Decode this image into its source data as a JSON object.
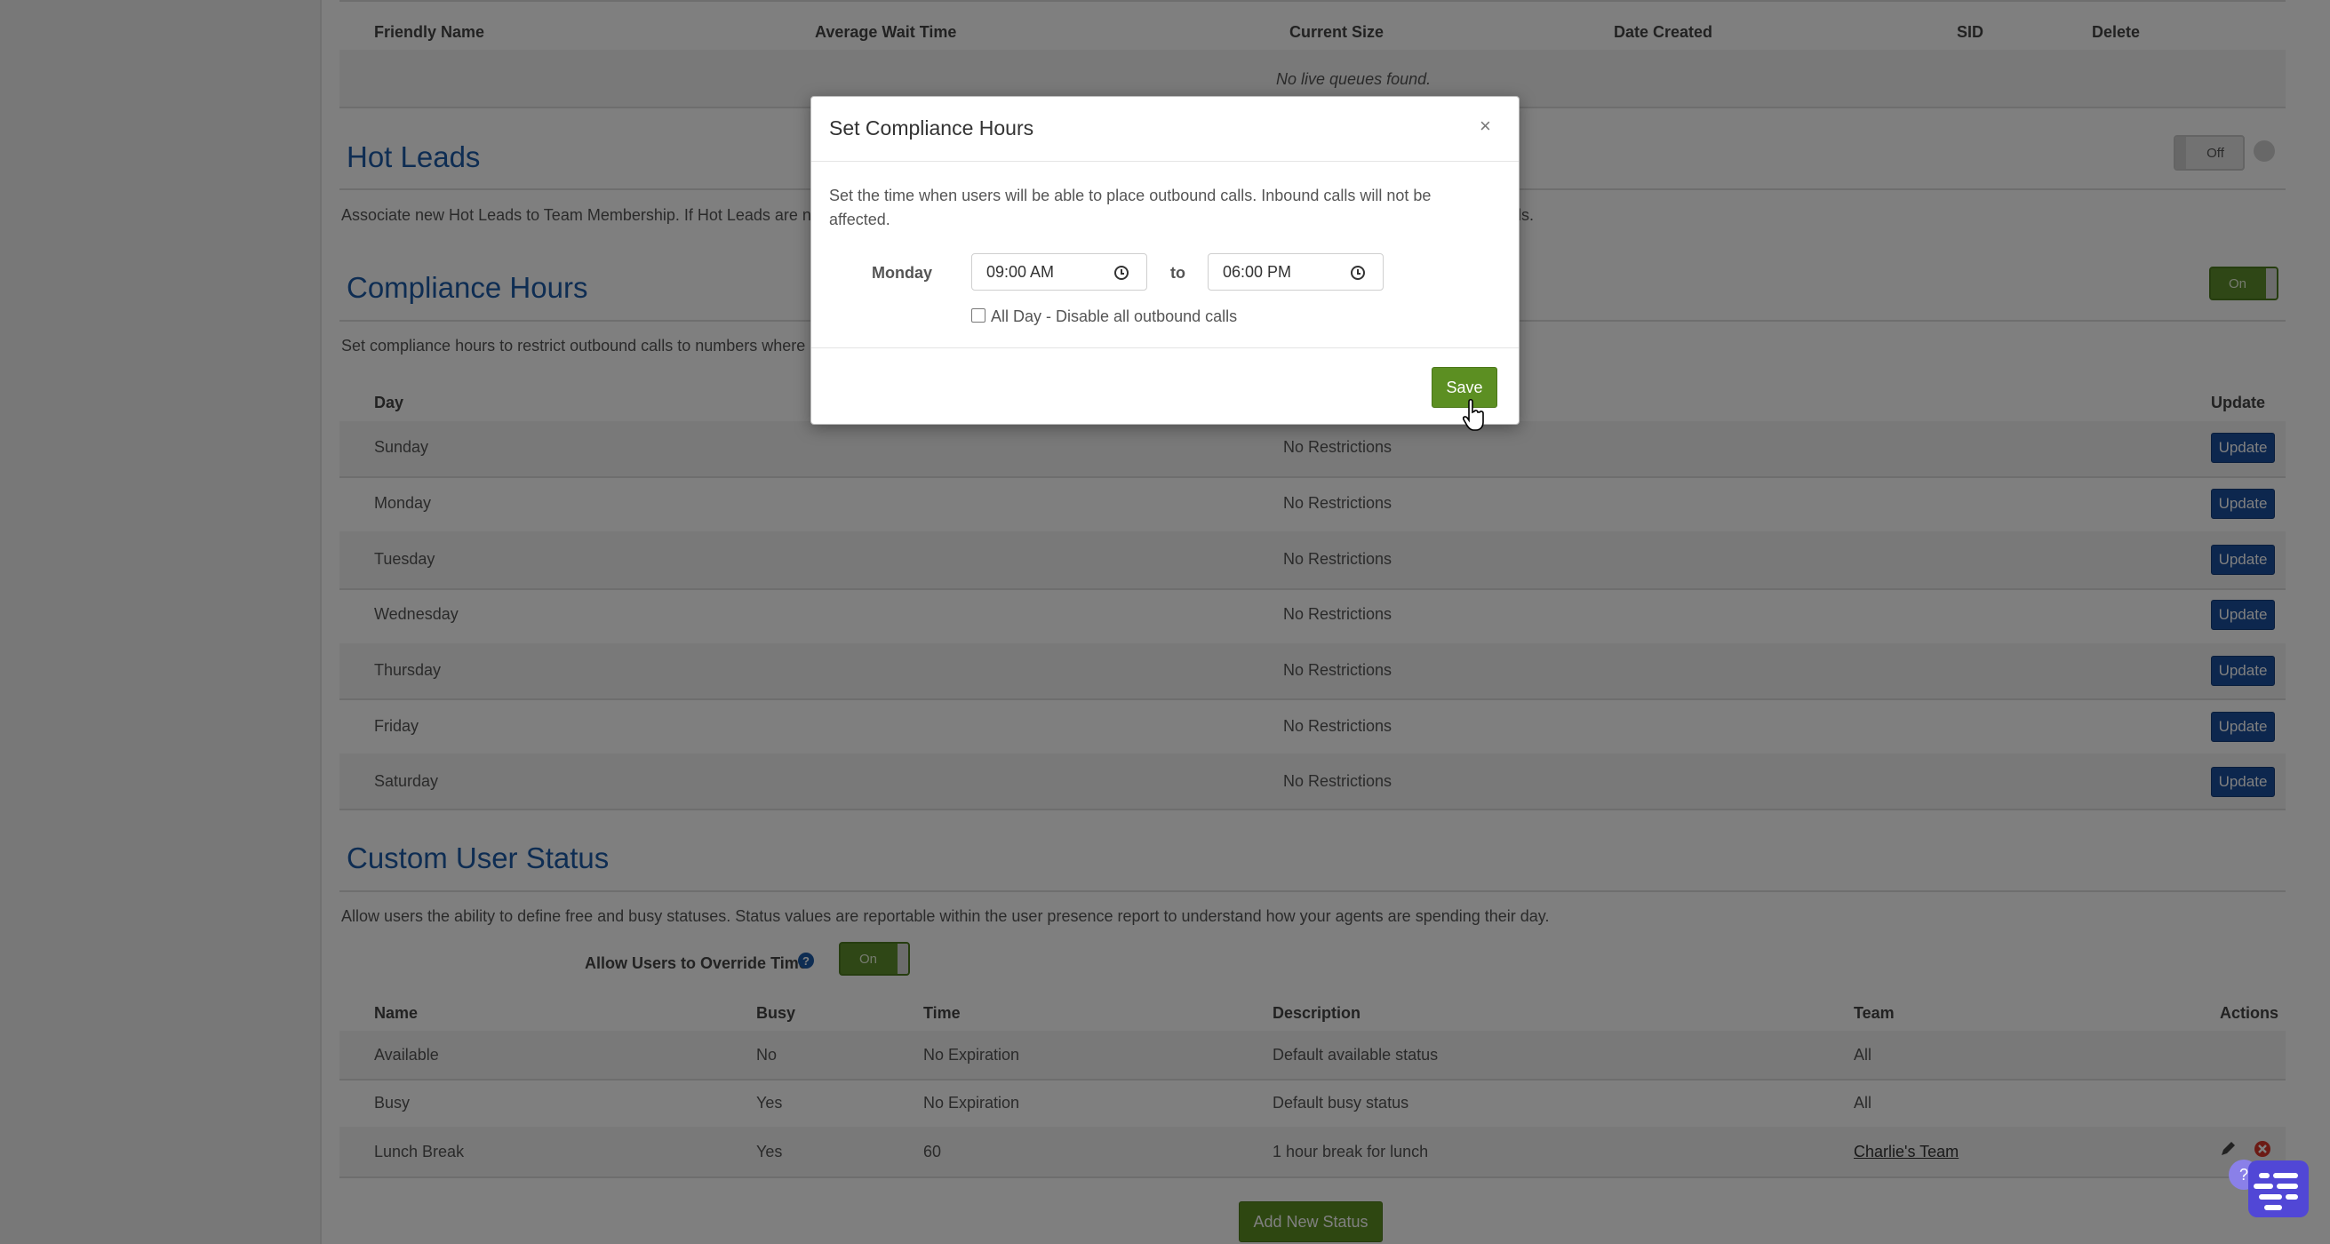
{
  "queues_table": {
    "headers": [
      "Friendly Name",
      "Average Wait Time",
      "Current Size",
      "Date Created",
      "SID",
      "Delete"
    ],
    "empty_text": "No live queues found."
  },
  "hot_leads": {
    "title": "Hot Leads",
    "description": "Associate new Hot Leads to Team Membership. If Hot Leads are no",
    "description_tail": "ds.",
    "toggle_label": "Off"
  },
  "compliance": {
    "title": "Compliance Hours",
    "description": "Set compliance hours to restrict outbound calls to numbers where",
    "toggle_label": "On",
    "headers": {
      "day": "Day",
      "update": "Update"
    },
    "rows": [
      {
        "day": "Sunday",
        "status": "No Restrictions",
        "action": "Update"
      },
      {
        "day": "Monday",
        "status": "No Restrictions",
        "action": "Update"
      },
      {
        "day": "Tuesday",
        "status": "No Restrictions",
        "action": "Update"
      },
      {
        "day": "Wednesday",
        "status": "No Restrictions",
        "action": "Update"
      },
      {
        "day": "Thursday",
        "status": "No Restrictions",
        "action": "Update"
      },
      {
        "day": "Friday",
        "status": "No Restrictions",
        "action": "Update"
      },
      {
        "day": "Saturday",
        "status": "No Restrictions",
        "action": "Update"
      }
    ]
  },
  "custom_status": {
    "title": "Custom User Status",
    "description": "Allow users the ability to define free and busy statuses. Status values are reportable within the user presence report to understand how your agents are spending their day.",
    "override_label": "Allow Users to Override Time",
    "override_toggle": "On",
    "headers": [
      "Name",
      "Busy",
      "Time",
      "Description",
      "Team",
      "Actions"
    ],
    "rows": [
      {
        "name": "Available",
        "busy": "No",
        "time": "No Expiration",
        "description": "Default available status",
        "team": "All"
      },
      {
        "name": "Busy",
        "busy": "Yes",
        "time": "No Expiration",
        "description": "Default busy status",
        "team": "All"
      },
      {
        "name": "Lunch Break",
        "busy": "Yes",
        "time": "60",
        "description": "1 hour break for lunch",
        "team": "Charlie's Team"
      }
    ],
    "add_button": "Add New Status"
  },
  "modal": {
    "title": "Set Compliance Hours",
    "close": "×",
    "text": "Set the time when users will be able to place outbound calls. Inbound calls will not be affected.",
    "day": "Monday",
    "start_time": "09:00 AM",
    "to_label": "to",
    "end_time": "06:00 PM",
    "all_day_label": "All Day - Disable all outbound calls",
    "all_day_checked": false,
    "save": "Save"
  },
  "help_glyph": "?",
  "colors": {
    "accent_blue": "#1d5aa6",
    "button_blue": "#1b4f9c",
    "green": "#5c8f22",
    "chat_purple": "#5147d6"
  }
}
